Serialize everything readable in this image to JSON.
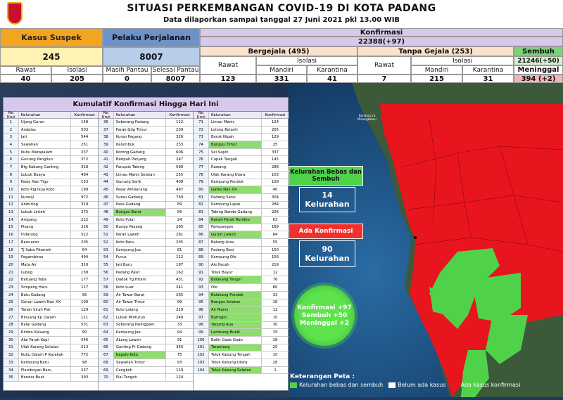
{
  "title": "SITUASI PERKEMBANGAN COVID-19 DI KOTA PADANG",
  "subtitle": "Data dilaporkan sampai tanggal 27 Juni 2021 pkl 13.00 WIB",
  "stats": {
    "kasus_suspek": {
      "label": "Kasus Suspek",
      "value": "245",
      "rawat_label": "Rawat",
      "rawat": "40",
      "isolasi_label": "Isolasi",
      "isolasi": "205"
    },
    "pelaku_perjalanan": {
      "label": "Pelaku Perjalanan",
      "value": "8007",
      "masih_label": "Masih Pantau",
      "masih": "0",
      "selesai_label": "Selesai Pantau",
      "selesai": "8007"
    },
    "konfirmasi": {
      "label": "Konfirmasi",
      "value": "22388(+97)"
    },
    "bergejala": {
      "label": "Bergejala (495)",
      "rawat_label": "Rawat",
      "rawat": "123",
      "isolasi_label": "Isolasi",
      "mandiri_label": "Mandiri",
      "mandiri": "331",
      "karantina_label": "Karantina",
      "karantina": "41"
    },
    "tanpa_gejala": {
      "label": "Tanpa Gejala (253)",
      "rawat_label": "Rawat",
      "rawat": "7",
      "isolasi_label": "Isolasi",
      "mandiri_label": "Mandiri",
      "mandiri": "215",
      "karantina_label": "Karantina",
      "karantina": "31"
    },
    "sembuh": {
      "label": "Sembuh",
      "value": "21246(+50)"
    },
    "meninggal": {
      "label": "Meninggal",
      "value": "394 (+2)"
    }
  },
  "table": {
    "title": "Kumulatif Konfirmasi Hingga Hari Ini",
    "headers": {
      "no": "No Urut",
      "name": "Kelurahan",
      "value": "Konfirmasi"
    },
    "rows": [
      [
        "1",
        "Ujung Gurun",
        "148",
        0
      ],
      [
        "2",
        "Andalas",
        "503",
        0
      ],
      [
        "3",
        "Jati",
        "544",
        0
      ],
      [
        "4",
        "Sawahan",
        "251",
        0
      ],
      [
        "5",
        "Kubu Marapalam",
        "237",
        0
      ],
      [
        "6",
        "Gunung Pangilun",
        "372",
        0
      ],
      [
        "7",
        "Btg Kabung Ganting",
        "318",
        0
      ],
      [
        "8",
        "Lubuk Buaya",
        "484",
        0
      ],
      [
        "9",
        "Pasie Nan Tigo",
        "153",
        0
      ],
      [
        "10",
        "Koto Pjg Ikua Koto",
        "199",
        0
      ],
      [
        "11",
        "Kuranji",
        "972",
        0
      ],
      [
        "12",
        "Anduring",
        "319",
        0
      ],
      [
        "13",
        "Lubuk Lintah",
        "272",
        0
      ],
      [
        "14",
        "Ampang",
        "222",
        0
      ],
      [
        "15",
        "Pisang",
        "216",
        0
      ],
      [
        "16",
        "Indarung",
        "512",
        0
      ],
      [
        "17",
        "Banuaran",
        "205",
        0
      ],
      [
        "18",
        "Tj Saba Pitameh",
        "64",
        0
      ],
      [
        "19",
        "Pagambiran",
        "494",
        0
      ],
      [
        "20",
        "Mata Air",
        "310",
        0
      ],
      [
        "21",
        "Lubeg",
        "158",
        0
      ],
      [
        "22",
        "Batuang Taba",
        "177",
        0
      ],
      [
        "23",
        "Simpang Haru",
        "117",
        0
      ],
      [
        "24",
        "Batu Gadang",
        "95",
        0
      ],
      [
        "25",
        "Gurun Laweh Nan XX",
        "100",
        0
      ],
      [
        "26",
        "Tanah Sirah Piai",
        "129",
        0
      ],
      [
        "27",
        "Binuang Kp Dalam",
        "111",
        0
      ],
      [
        "28",
        "Balai Gadang",
        "531",
        0
      ],
      [
        "29",
        "Rimbo Kaluang",
        "90",
        0
      ],
      [
        "30",
        "Alai Parak Kopi",
        "546",
        0
      ],
      [
        "31",
        "Ulak Karang Selatan",
        "213",
        0
      ],
      [
        "32",
        "Kubu Dalam P Karakah",
        "772",
        0
      ],
      [
        "33",
        "Kampung Baru",
        "98",
        0
      ],
      [
        "34",
        "Flamboyan Baru",
        "237",
        0
      ],
      [
        "35",
        "Bandar Buat",
        "393",
        0
      ],
      [
        "36",
        "Seberang Padang",
        "112",
        0
      ],
      [
        "37",
        "Parak Gdg Timur",
        "239",
        0
      ],
      [
        "38",
        "Kurao Pagang",
        "326",
        0
      ],
      [
        "39",
        "Kalumbuk",
        "233",
        0
      ],
      [
        "40",
        "Korong Gadang",
        "606",
        0
      ],
      [
        "41",
        "Batipuh Panjang",
        "247",
        0
      ],
      [
        "42",
        "Parupuk Tabing",
        "598",
        0
      ],
      [
        "43",
        "Limau Manis Selatan",
        "255",
        0
      ],
      [
        "44",
        "Gunung Sarik",
        "408",
        0
      ],
      [
        "45",
        "Pasar Ambacang",
        "487",
        0
      ],
      [
        "46",
        "Surau Gadang",
        "769",
        0
      ],
      [
        "47",
        "Pasa Gadang",
        "89",
        0
      ],
      [
        "48",
        "Bungus Barat",
        "56",
        1
      ],
      [
        "49",
        "Koto Pulai",
        "24",
        0
      ],
      [
        "50",
        "Bungo Pasang",
        "285",
        0
      ],
      [
        "51",
        "Parak Laweh",
        "291",
        0
      ],
      [
        "52",
        "Koto Baru",
        "205",
        0
      ],
      [
        "53",
        "Kampung Jua",
        "81",
        0
      ],
      [
        "54",
        "Purus",
        "112",
        0
      ],
      [
        "55",
        "Jati Baru",
        "187",
        0
      ],
      [
        "56",
        "Padang Pasir",
        "162",
        0
      ],
      [
        "57",
        "Dadok Tg Hitam",
        "431",
        0
      ],
      [
        "58",
        "Koto Luar",
        "241",
        0
      ],
      [
        "59",
        "Air Tawar Barat",
        "265",
        0
      ],
      [
        "60",
        "Air Tawar Timur",
        "99",
        0
      ],
      [
        "61",
        "Koto Lalang",
        "218",
        0
      ],
      [
        "62",
        "Lubuk Minturun",
        "248",
        0
      ],
      [
        "63",
        "Seberang Palinggam",
        "33",
        0
      ],
      [
        "64",
        "Kampung Jao",
        "94",
        0
      ],
      [
        "65",
        "ALang Laweh",
        "91",
        0
      ],
      [
        "66",
        "Ganting Pr Gadang",
        "356",
        0
      ],
      [
        "67",
        "Kapalo Koto",
        "75",
        1
      ],
      [
        "68",
        "Sawahan Timur",
        "93",
        0
      ],
      [
        "69",
        "Cengkeh",
        "119",
        0
      ],
      [
        "70",
        "Piai Tangah",
        "124",
        0
      ],
      [
        "71",
        "Limau Manis",
        "124",
        0
      ],
      [
        "72",
        "Lolong Belanti",
        "205",
        0
      ],
      [
        "73",
        "Berok Nipah",
        "129",
        0
      ],
      [
        "74",
        "Bungus Timur",
        "25",
        1
      ],
      [
        "75",
        "Sei Sapih",
        "337",
        0
      ],
      [
        "76",
        "Cupak Tangah",
        "145",
        0
      ],
      [
        "77",
        "Rawang",
        "288",
        0
      ],
      [
        "78",
        "Ulak Karang Utara",
        "103",
        0
      ],
      [
        "79",
        "Kampung Pondok",
        "108",
        0
      ],
      [
        "80",
        "Gates Nan XX",
        "40",
        1
      ],
      [
        "81",
        "Padang Sarai",
        "304",
        0
      ],
      [
        "82",
        "Kampung Lapai",
        "284",
        0
      ],
      [
        "83",
        "Tabing Banda Gadang",
        "206",
        0
      ],
      [
        "84",
        "Ranah Parak Rumbio",
        "63",
        1
      ],
      [
        "85",
        "Pampangan",
        "169",
        0
      ],
      [
        "86",
        "Gurun Laweh",
        "84",
        1
      ],
      [
        "87",
        "Batang Arau",
        "55",
        0
      ],
      [
        "88",
        "Padang Besi",
        "150",
        0
      ],
      [
        "89",
        "Kampung Olo",
        "156",
        0
      ],
      [
        "90",
        "Aie Pacah",
        "219",
        0
      ],
      [
        "91",
        "Teluk Bayur",
        "12",
        0
      ],
      [
        "92",
        "Belakang Tangsi",
        "76",
        1
      ],
      [
        "93",
        "Olo",
        "80",
        0
      ],
      [
        "94",
        "Belakang Pondok",
        "33",
        1
      ],
      [
        "95",
        "Bungus Selatan",
        "18",
        1
      ],
      [
        "96",
        "Air Manis",
        "12",
        1
      ],
      [
        "97",
        "Baringin",
        "10",
        1
      ],
      [
        "98",
        "Tarjung Aua",
        "30",
        1
      ],
      [
        "99",
        "Lambung Bukik",
        "15",
        1
      ],
      [
        "100",
        "Bukit Gado Gado",
        "18",
        0
      ],
      [
        "101",
        "Tarantang",
        "25",
        1
      ],
      [
        "102",
        "Teluk Kabung Tengah",
        "15",
        0
      ],
      [
        "103",
        "Teluk Kabung Utara",
        "28",
        0
      ],
      [
        "104",
        "Teluk Kabung Selatan",
        "1",
        1
      ]
    ]
  },
  "map": {
    "bebas_label": "Kelurahan Bebas dan Sembuh",
    "bebas_value": "14",
    "bebas_unit": "Kelurahan",
    "ada_label": "Ada Konfirmasi",
    "ada_value": "90",
    "ada_unit": "Kelurahan",
    "circle_line1": "Konfirmasi +97",
    "circle_line2": "Sembuh +50",
    "circle_line3": "Meninggal +2",
    "place_label": "Bandara Int.\nMinangkabau"
  },
  "legend": {
    "title": "Keterangan Peta :",
    "green": "Kelurahan bebas dan sembuh",
    "white": "Belum ada kasus",
    "red": "Ada kasus konfirmasi"
  },
  "colors": {
    "red": "#e8141e",
    "green": "#4fd24a",
    "yellow_row": "#fff2b3",
    "blue_head": "#b8cde8",
    "orange_head": "#f3a51f"
  }
}
